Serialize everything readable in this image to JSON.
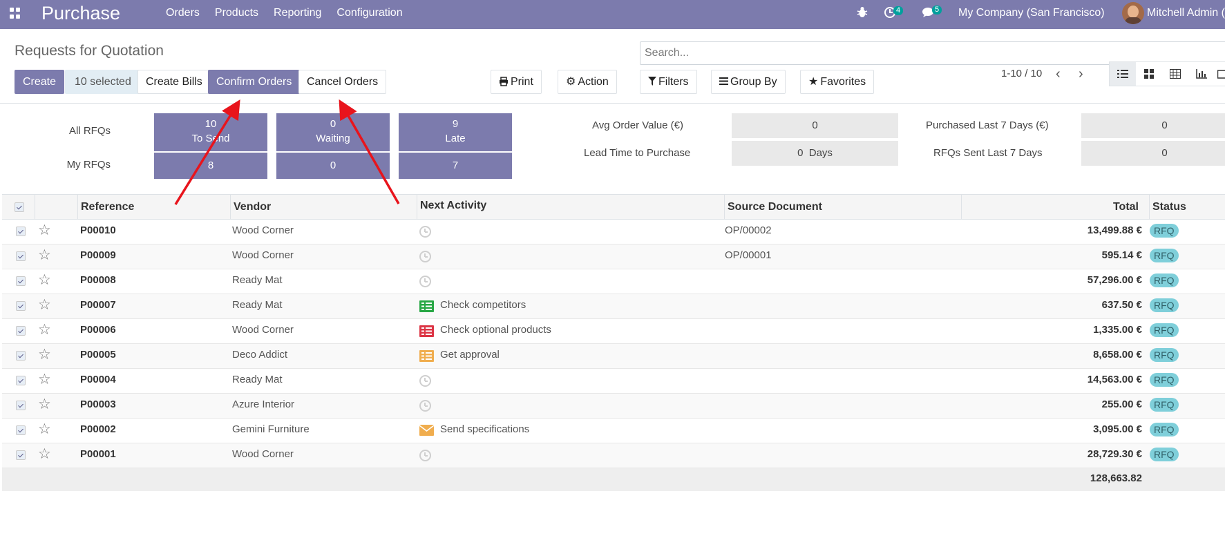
{
  "navbar": {
    "app_name": "Purchase",
    "menu": [
      "Orders",
      "Products",
      "Reporting",
      "Configuration"
    ],
    "activity_count": "4",
    "message_count": "5",
    "company": "My Company (San Francisco)",
    "user": "Mitchell Admin (d"
  },
  "control_panel": {
    "title": "Requests for Quotation",
    "search_placeholder": "Search...",
    "create": "Create",
    "selected": "10 selected",
    "create_bills": "Create Bills",
    "confirm_orders": "Confirm Orders",
    "cancel_orders": "Cancel Orders",
    "print": "Print",
    "action": "Action",
    "filters": "Filters",
    "group_by": "Group By",
    "favorites": "Favorites",
    "pager": "1-10 / 10"
  },
  "dashboard": {
    "all_rfqs": "All RFQs",
    "my_rfqs": "My RFQs",
    "tiles": [
      {
        "count": "10",
        "label": "To Send",
        "mine": "8"
      },
      {
        "count": "0",
        "label": "Waiting",
        "mine": "0"
      },
      {
        "count": "9",
        "label": "Late",
        "mine": "7"
      }
    ],
    "kpis": [
      {
        "label": "Avg Order Value (€)",
        "value": "0"
      },
      {
        "label": "Lead Time to Purchase",
        "value": "0  Days"
      },
      {
        "label": "Purchased Last 7 Days (€)",
        "value": "0"
      },
      {
        "label": "RFQs Sent Last 7 Days",
        "value": "0"
      }
    ]
  },
  "table": {
    "headers": {
      "reference": "Reference",
      "vendor": "Vendor",
      "activity": "Next Activity",
      "source": "Source Document",
      "total": "Total",
      "status": "Status"
    },
    "rows": [
      {
        "ref": "P00010",
        "vendor": "Wood Corner",
        "activity": "",
        "activity_icon": "clock-icon",
        "source": "OP/00002",
        "total": "13,499.88 €",
        "status": "RFQ"
      },
      {
        "ref": "P00009",
        "vendor": "Wood Corner",
        "activity": "",
        "activity_icon": "clock-icon",
        "source": "OP/00001",
        "total": "595.14 €",
        "status": "RFQ"
      },
      {
        "ref": "P00008",
        "vendor": "Ready Mat",
        "activity": "",
        "activity_icon": "clock-icon",
        "source": "",
        "total": "57,296.00 €",
        "status": "RFQ"
      },
      {
        "ref": "P00007",
        "vendor": "Ready Mat",
        "activity": "Check competitors",
        "activity_icon": "tasks-icon",
        "activity_color": "#28a745",
        "source": "",
        "total": "637.50 €",
        "status": "RFQ"
      },
      {
        "ref": "P00006",
        "vendor": "Wood Corner",
        "activity": "Check optional products",
        "activity_icon": "tasks-icon",
        "activity_color": "#dc3545",
        "source": "",
        "total": "1,335.00 €",
        "status": "RFQ"
      },
      {
        "ref": "P00005",
        "vendor": "Deco Addict",
        "activity": "Get approval",
        "activity_icon": "tasks-icon",
        "activity_color": "#f0ad4e",
        "source": "",
        "total": "8,658.00 €",
        "status": "RFQ"
      },
      {
        "ref": "P00004",
        "vendor": "Ready Mat",
        "activity": "",
        "activity_icon": "clock-icon",
        "source": "",
        "total": "14,563.00 €",
        "status": "RFQ"
      },
      {
        "ref": "P00003",
        "vendor": "Azure Interior",
        "activity": "",
        "activity_icon": "clock-icon",
        "source": "",
        "total": "255.00 €",
        "status": "RFQ"
      },
      {
        "ref": "P00002",
        "vendor": "Gemini Furniture",
        "activity": "Send specifications",
        "activity_icon": "envelope-icon",
        "activity_color": "#f0ad4e",
        "source": "",
        "total": "3,095.00 €",
        "status": "RFQ"
      },
      {
        "ref": "P00001",
        "vendor": "Wood Corner",
        "activity": "",
        "activity_icon": "clock-icon",
        "source": "",
        "total": "28,729.30 €",
        "status": "RFQ"
      }
    ],
    "grand_total": "128,663.82"
  },
  "colors": {
    "brand": "#7c7bad",
    "status_badge": "#7fcfda",
    "annotation_arrow": "#e8141c"
  }
}
